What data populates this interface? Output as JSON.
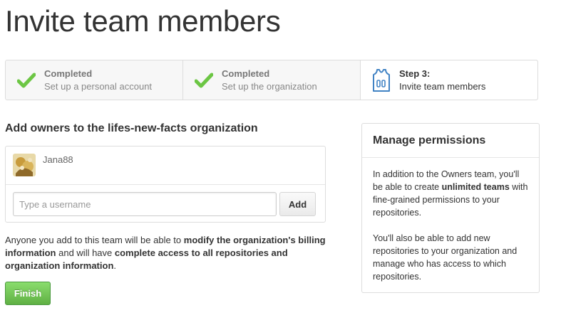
{
  "page": {
    "title": "Invite team members"
  },
  "steps": [
    {
      "status": "Completed",
      "desc": "Set up a personal account",
      "icon": "check-icon"
    },
    {
      "status": "Completed",
      "desc": "Set up the organization",
      "icon": "check-icon"
    },
    {
      "status": "Step 3:",
      "desc": "Invite team members",
      "icon": "jersey-icon"
    }
  ],
  "owners": {
    "title": "Add owners to the lifes-new-facts organization",
    "members": [
      {
        "name": "Jana88"
      }
    ],
    "input_placeholder": "Type a username",
    "input_value": "",
    "add_label": "Add"
  },
  "notice": {
    "p1": "Anyone you add to this team will be able to ",
    "b1": "modify the organization's billing information",
    "p2": " and will have ",
    "b2": "complete access to all repositories and organization information",
    "p3": "."
  },
  "finish_label": "Finish",
  "permissions": {
    "title": "Manage permissions",
    "para1_a": "In addition to the Owners team, you'll be able to create ",
    "para1_b": "unlimited teams",
    "para1_c": " with fine-grained permissions to your repositories.",
    "para2": "You'll also be able to add new repositories to your organization and manage who has access to which repositories."
  },
  "colors": {
    "check_green": "#6cc644",
    "finish_green": "#60b044",
    "jersey_blue": "#4183c4"
  }
}
